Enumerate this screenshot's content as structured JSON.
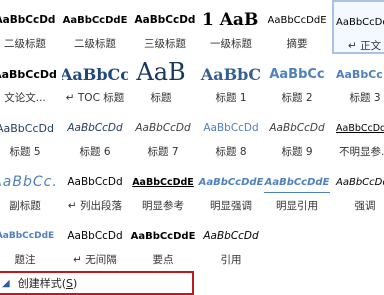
{
  "styles": [
    {
      "id": "r0c0",
      "preview": "AaBbCcDd",
      "label": "二级标题"
    },
    {
      "id": "r0c1",
      "preview": "AaBbCcDdE",
      "label": "二级标题"
    },
    {
      "id": "r0c2",
      "preview": "AaBbCcDd",
      "label": "三级标题"
    },
    {
      "id": "r0c3",
      "preview": "1 AaB",
      "label": "一级标题"
    },
    {
      "id": "r0c4",
      "preview": "AaBbCcDdE",
      "label": "摘要"
    },
    {
      "id": "r0c5",
      "preview": "AaBbCcDd",
      "label": "↵ 正文",
      "selected": true
    },
    {
      "id": "r1c0",
      "preview": "AaBbCcDd",
      "label": "文论文..."
    },
    {
      "id": "r1c1",
      "preview": "AaBbCc",
      "label": "↵ TOC 标题"
    },
    {
      "id": "r1c2",
      "preview": "AaB",
      "label": "标题"
    },
    {
      "id": "r1c3",
      "preview": "AaBbC",
      "label": "标题 1"
    },
    {
      "id": "r1c4",
      "preview": "AaBbCc",
      "label": "标题 2"
    },
    {
      "id": "r1c5",
      "preview": "AaBbCc",
      "label": "标题 3"
    },
    {
      "id": "r2c0",
      "preview": "AaBbCcDd",
      "label": "标题 5"
    },
    {
      "id": "r2c1",
      "preview": "AaBbCcDd",
      "label": "标题 6"
    },
    {
      "id": "r2c2",
      "preview": "AaBbCcDd",
      "label": "标题 7"
    },
    {
      "id": "r2c3",
      "preview": "AaBbCcDd",
      "label": "标题 8"
    },
    {
      "id": "r2c4",
      "preview": "AaBbCcDd",
      "label": "标题 9"
    },
    {
      "id": "r2c5",
      "preview": "AaBbCcDd",
      "label": "不明显参..."
    },
    {
      "id": "r3c0",
      "preview": "AaBbCc.",
      "label": "副标题"
    },
    {
      "id": "r3c1",
      "preview": "AaBbCcDd",
      "label": "↵ 列出段落"
    },
    {
      "id": "r3c2",
      "preview": "AaBbCcDdE",
      "label": "明显参考"
    },
    {
      "id": "r3c3",
      "preview": "AaBbCcDdE",
      "label": "明显强调"
    },
    {
      "id": "r3c4",
      "preview": "AaBbCcDdE",
      "label": "明显引用"
    },
    {
      "id": "r3c5",
      "preview": "AaBbCcDd",
      "label": "强调"
    },
    {
      "id": "r4c0",
      "preview": "AaBbCcDdE",
      "label": "题注"
    },
    {
      "id": "r4c1",
      "preview": "AaBbCcDd",
      "label": "↵ 无间隔"
    },
    {
      "id": "r4c2",
      "preview": "AaBbCcDdE",
      "label": "要点"
    },
    {
      "id": "r4c3",
      "preview": "AaBbCcDd",
      "label": "引用"
    }
  ],
  "footer": {
    "create_label": "创建样式(",
    "create_key": "S",
    "create_close": ")"
  }
}
